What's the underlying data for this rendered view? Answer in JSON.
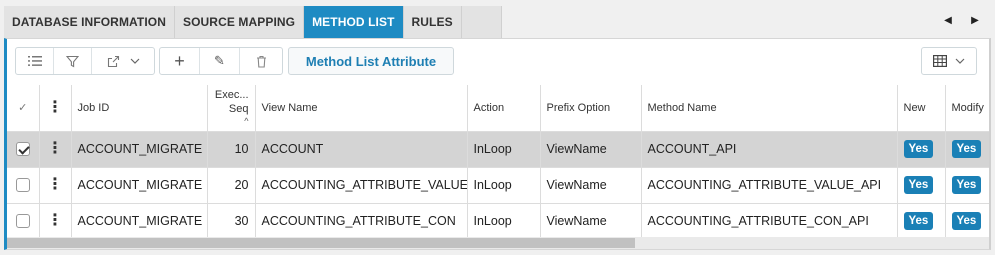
{
  "tabs": [
    {
      "label": "DATABASE INFORMATION",
      "active": false
    },
    {
      "label": "SOURCE MAPPING",
      "active": false
    },
    {
      "label": "METHOD LIST",
      "active": true
    },
    {
      "label": "RULES",
      "active": false
    }
  ],
  "tab_scroll": {
    "left_icon": "caret-left-icon",
    "right_icon": "caret-right-icon",
    "left_glyph": "◀",
    "right_glyph": "▶"
  },
  "toolbar": {
    "method_list_attribute_label": "Method List Attribute",
    "icons": [
      "list-icon",
      "filter-icon",
      "export-icon",
      "chevron-down-icon",
      "add-icon",
      "edit-icon",
      "delete-icon",
      "table-view-icon",
      "chevron-down-icon"
    ],
    "add_glyph": "+",
    "edit_glyph": "✎",
    "delete_glyph": "🗑"
  },
  "grid": {
    "columns": {
      "select": "✓",
      "menu": "⋮",
      "job_id": "Job ID",
      "exec_seq_line1": "Exec...",
      "exec_seq_line2": "Seq",
      "sort_indicator": "^",
      "view_name": "View Name",
      "action": "Action",
      "prefix_option": "Prefix Option",
      "method_name": "Method Name",
      "new": "New",
      "modify": "Modify"
    },
    "rows": [
      {
        "selected": true,
        "menu": "⋮",
        "job_id": "ACCOUNT_MIGRATE",
        "exec_seq": "10",
        "view_name": "ACCOUNT",
        "action": "InLoop",
        "prefix_option": "ViewName",
        "method_name": "ACCOUNT_API",
        "new": "Yes",
        "modify": "Yes"
      },
      {
        "selected": false,
        "menu": "⋮",
        "job_id": "ACCOUNT_MIGRATE",
        "exec_seq": "20",
        "view_name": "ACCOUNTING_ATTRIBUTE_VALUE",
        "action": "InLoop",
        "prefix_option": "ViewName",
        "method_name": "ACCOUNTING_ATTRIBUTE_VALUE_API",
        "new": "Yes",
        "modify": "Yes"
      },
      {
        "selected": false,
        "menu": "⋮",
        "job_id": "ACCOUNT_MIGRATE",
        "exec_seq": "30",
        "view_name": "ACCOUNTING_ATTRIBUTE_CON",
        "action": "InLoop",
        "prefix_option": "ViewName",
        "method_name": "ACCOUNTING_ATTRIBUTE_CON_API",
        "new": "Yes",
        "modify": "Yes"
      }
    ]
  },
  "colors": {
    "accent": "#1e8bc3",
    "yes_badge": "#1a80b6",
    "selected_row": "#d4d4d4"
  }
}
